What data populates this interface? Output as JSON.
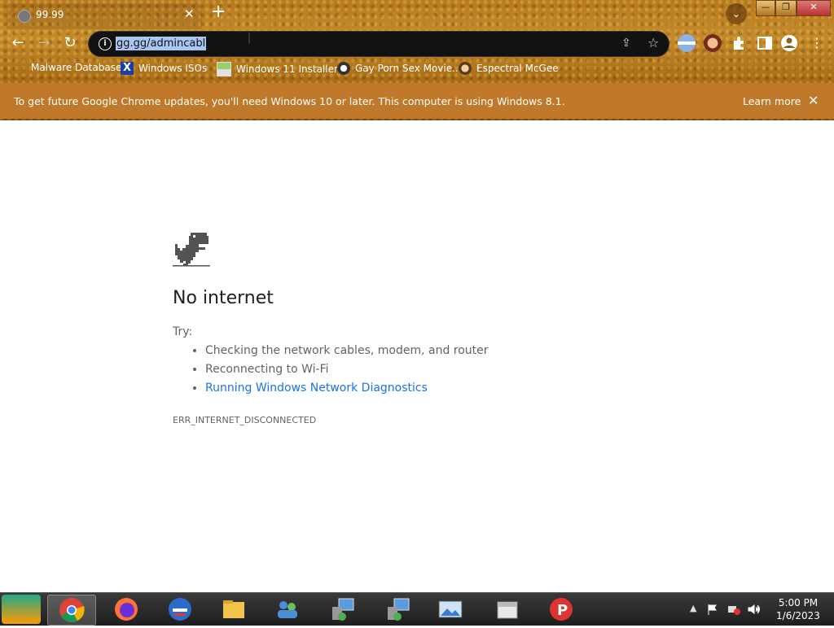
{
  "browser": {
    "tab": {
      "title": "99.99",
      "close": "✕"
    },
    "new_tab": "+",
    "tab_search": "⌄",
    "window_controls": {
      "minimize": "—",
      "restore": "❐",
      "close": "✕"
    },
    "nav": {
      "back": "←",
      "forward": "→",
      "reload": "↻"
    },
    "address_bar": {
      "url": "gg.gg/admincabl",
      "info": "i",
      "share": "⇪",
      "bookmark": "☆"
    }
  },
  "bookmarks": [
    {
      "label": "Malware Database"
    },
    {
      "label": "Windows ISOs"
    },
    {
      "label": "Windows 11 Installer"
    },
    {
      "label": "Gay Porn Sex Movie..."
    },
    {
      "label": "Espectral McGee"
    }
  ],
  "infobar": {
    "message": "To get future Google Chrome updates, you'll need Windows 10 or later. This computer is using Windows 8.1.",
    "learn_more": "Learn more",
    "close": "✕"
  },
  "error_page": {
    "heading": "No internet",
    "try_label": "Try:",
    "tips": [
      "Checking the network cables, modem, and router",
      "Reconnecting to Wi-Fi",
      "Running Windows Network Diagnostics"
    ],
    "error_code": "ERR_INTERNET_DISCONNECTED"
  },
  "taskbar": {
    "clock_time": "5:00 PM",
    "clock_date": "1/6/2023",
    "tray_arrow": "▲"
  },
  "colors": {
    "link": "#1a73e8",
    "infobar": "#c0782a",
    "selection": "#a9c7f5"
  }
}
